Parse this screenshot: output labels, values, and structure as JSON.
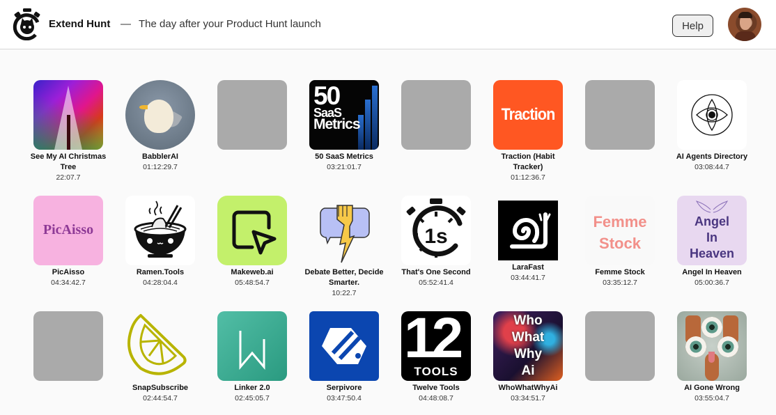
{
  "header": {
    "brand": "Extend Hunt",
    "separator": "—",
    "tagline": "The day after your Product Hunt launch",
    "help_label": "Help",
    "logo_icon": "stopwatch-cat-icon",
    "avatar_alt": "user-avatar"
  },
  "products": [
    {
      "name": "See My AI Christmas Tree",
      "time": "22:07.7",
      "thumb": "xmas"
    },
    {
      "name": "BabblerAI",
      "time": "01:12:29.7",
      "thumb": "babbler"
    },
    {
      "name": "",
      "time": "",
      "thumb": "placeholder"
    },
    {
      "name": "50 SaaS Metrics",
      "time": "03:21:01.7",
      "thumb": "saas",
      "art": {
        "line1": "50",
        "line2": "SaaS",
        "line3": "Metrics"
      }
    },
    {
      "name": "",
      "time": "",
      "thumb": "placeholder"
    },
    {
      "name": "Traction (Habit Tracker)",
      "time": "01:12:36.7",
      "thumb": "traction",
      "art": {
        "text": "Traction"
      }
    },
    {
      "name": "",
      "time": "",
      "thumb": "placeholder"
    },
    {
      "name": "AI Agents Directory",
      "time": "03:08:44.7",
      "thumb": "eye"
    },
    {
      "name": "PicAisso",
      "time": "04:34:42.7",
      "thumb": "picaisso",
      "art": {
        "text": "PicAisso"
      }
    },
    {
      "name": "Ramen.Tools",
      "time": "04:28:04.4",
      "thumb": "ramen"
    },
    {
      "name": "Makeweb.ai",
      "time": "05:48:54.7",
      "thumb": "makeweb"
    },
    {
      "name": "Debate Better, Decide Smarter.",
      "time": "10:22.7",
      "thumb": "debate"
    },
    {
      "name": "That's One Second",
      "time": "05:52:41.4",
      "thumb": "onesecond",
      "art": {
        "text": "1s"
      }
    },
    {
      "name": "LaraFast",
      "time": "03:44:41.7",
      "thumb": "snail"
    },
    {
      "name": "Femme Stock",
      "time": "03:35:12.7",
      "thumb": "femme",
      "art": {
        "line1": "Femme",
        "line2": "Stock"
      }
    },
    {
      "name": "Angel In Heaven",
      "time": "05:00:36.7",
      "thumb": "angel",
      "art": {
        "line1": "Angel",
        "line2": "In",
        "line3": "Heaven"
      }
    },
    {
      "name": "",
      "time": "",
      "thumb": "placeholder"
    },
    {
      "name": "SnapSubscribe",
      "time": "02:44:54.7",
      "thumb": "lemon"
    },
    {
      "name": "Linker 2.0",
      "time": "02:45:05.7",
      "thumb": "linker"
    },
    {
      "name": "Serpivore",
      "time": "03:47:50.4",
      "thumb": "serpivore"
    },
    {
      "name": "Twelve Tools",
      "time": "04:48:08.7",
      "thumb": "twelve",
      "art": {
        "num": "12",
        "text": "TOOLS"
      }
    },
    {
      "name": "WhoWhatWhyAi",
      "time": "03:34:51.7",
      "thumb": "who",
      "art": {
        "line1": "Who",
        "line2": "What",
        "line3": "Why",
        "line4": "Ai"
      }
    },
    {
      "name": "",
      "time": "",
      "thumb": "placeholder"
    },
    {
      "name": "AI Gone Wrong",
      "time": "03:55:04.7",
      "thumb": "gone"
    }
  ],
  "colors": {
    "traction": "#ff5722",
    "makeweb": "#c3f06b",
    "picaisso": "#f7b2e0",
    "angel": "#e8d8f0",
    "serpivore": "#0b46b0",
    "lemon": "#b8b400",
    "placeholder": "#aaaaaa"
  }
}
